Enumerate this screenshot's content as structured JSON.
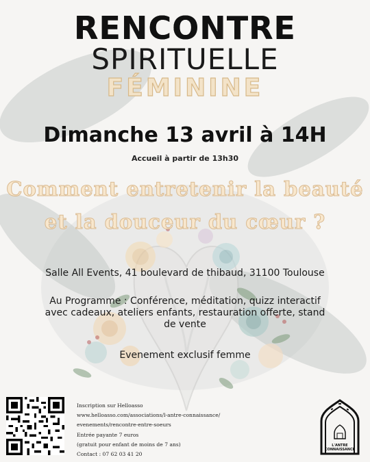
{
  "header": {
    "line1": "RENCONTRE",
    "line2": "SPIRITUELLE",
    "line3": "FÉMININE"
  },
  "event": {
    "date": "Dimanche 13 avril à 14H",
    "accueil": "Accueil à partir de 13h30",
    "question_line1": "Comment entretenir la beauté",
    "question_line2": "et la douceur du cœur ?",
    "salle": "Salle All Events, 41 boulevard de thibaud, 31100 Toulouse",
    "programme_label": "Au Programme :",
    "programme_text": " Conférence, méditation, quizz interactif avec cadeaux, ateliers enfants, restauration offerte, stand de vente",
    "exclusif": "Evenement exclusif femme"
  },
  "info": {
    "line1": "Inscription sur Helloasso",
    "line2": "www.helloasso.com/associations/l-antre-connaissance/",
    "line3": "evenements/rencontre-entre-soeurs",
    "line4": "Entrée payante 7 euros",
    "line5": "(gratuit pour enfant de moins de 7 ans)",
    "line6": "Contact : 07 62 03 41 20"
  },
  "logo": {
    "text_line1": "L'ANTRE",
    "text_line2": "CONNAISSANCE"
  },
  "colors": {
    "accent_gold": "#d7b888",
    "accent_cream": "#f3e3c8",
    "text_dark": "#111111",
    "background": "#f6f5f3"
  },
  "icons": [
    "qr-code",
    "mosque-arch-logo",
    "floral-heart-illustration"
  ]
}
